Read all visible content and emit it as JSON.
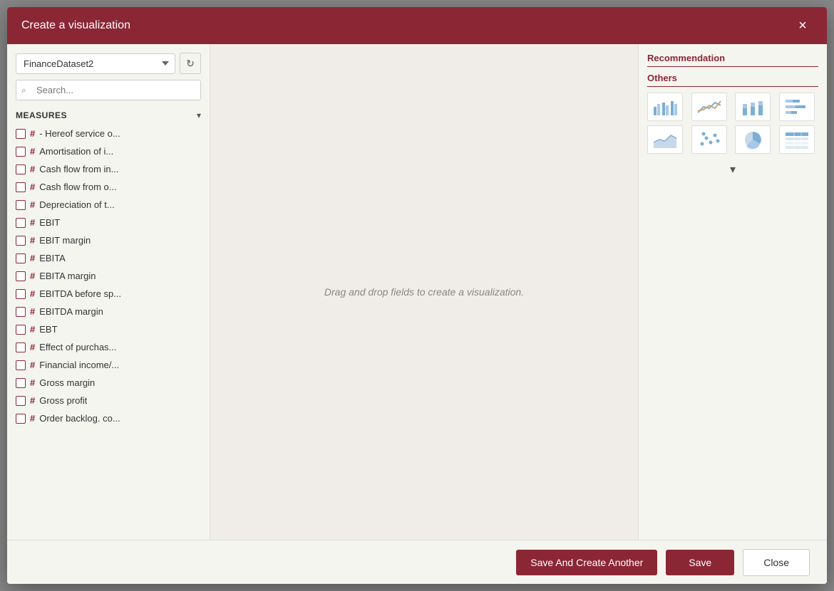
{
  "dialog": {
    "title": "Create a visualization",
    "close_label": "×"
  },
  "left": {
    "dataset": "FinanceDataset2",
    "search_placeholder": "Search...",
    "measures_label": "MEASURES",
    "measures": [
      {
        "name": "- Hereof service o..."
      },
      {
        "name": "Amortisation of i..."
      },
      {
        "name": "Cash flow from in..."
      },
      {
        "name": "Cash flow from o..."
      },
      {
        "name": "Depreciation of t..."
      },
      {
        "name": "EBIT"
      },
      {
        "name": "EBIT margin"
      },
      {
        "name": "EBITA"
      },
      {
        "name": "EBITA margin"
      },
      {
        "name": "EBITDA before sp..."
      },
      {
        "name": "EBITDA margin"
      },
      {
        "name": "EBT"
      },
      {
        "name": "Effect of purchas..."
      },
      {
        "name": "Financial income/..."
      },
      {
        "name": "Gross margin"
      },
      {
        "name": "Gross profit"
      },
      {
        "name": "Order backlog. co..."
      }
    ]
  },
  "center": {
    "drag_drop_text": "Drag and drop fields to create a visualization."
  },
  "right": {
    "recommendation_label": "Recommendation",
    "others_label": "Others"
  },
  "footer": {
    "save_create_label": "Save And Create Another",
    "save_label": "Save",
    "close_label": "Close"
  }
}
